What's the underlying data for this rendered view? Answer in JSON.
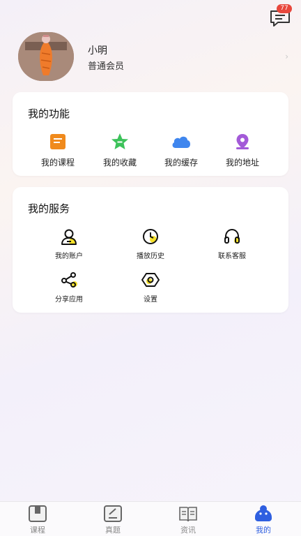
{
  "header": {
    "message_badge": "77"
  },
  "profile": {
    "name": "小明",
    "membership": "普通会员"
  },
  "functions": {
    "title": "我的功能",
    "items": [
      {
        "label": "我的课程",
        "icon": "course-icon",
        "color": "#f08a1c"
      },
      {
        "label": "我的收藏",
        "icon": "star-icon",
        "color": "#3cc25a"
      },
      {
        "label": "我的缓存",
        "icon": "cloud-icon",
        "color": "#3f86ee"
      },
      {
        "label": "我的地址",
        "icon": "location-icon",
        "color": "#a35ad8"
      }
    ]
  },
  "services": {
    "title": "我的服务",
    "items": [
      {
        "label": "我的账户",
        "icon": "user-icon"
      },
      {
        "label": "播放历史",
        "icon": "clock-icon"
      },
      {
        "label": "联系客服",
        "icon": "headset-icon"
      },
      {
        "label": "分享应用",
        "icon": "share-icon"
      },
      {
        "label": "设置",
        "icon": "settings-icon"
      }
    ],
    "accent": "#f5e12a"
  },
  "tabbar": {
    "items": [
      {
        "label": "课程",
        "icon": "course-tab-icon",
        "active": false
      },
      {
        "label": "真题",
        "icon": "exam-tab-icon",
        "active": false
      },
      {
        "label": "资讯",
        "icon": "news-tab-icon",
        "active": false
      },
      {
        "label": "我的",
        "icon": "profile-tab-icon",
        "active": true
      }
    ],
    "active_color": "#2f5fe0"
  }
}
